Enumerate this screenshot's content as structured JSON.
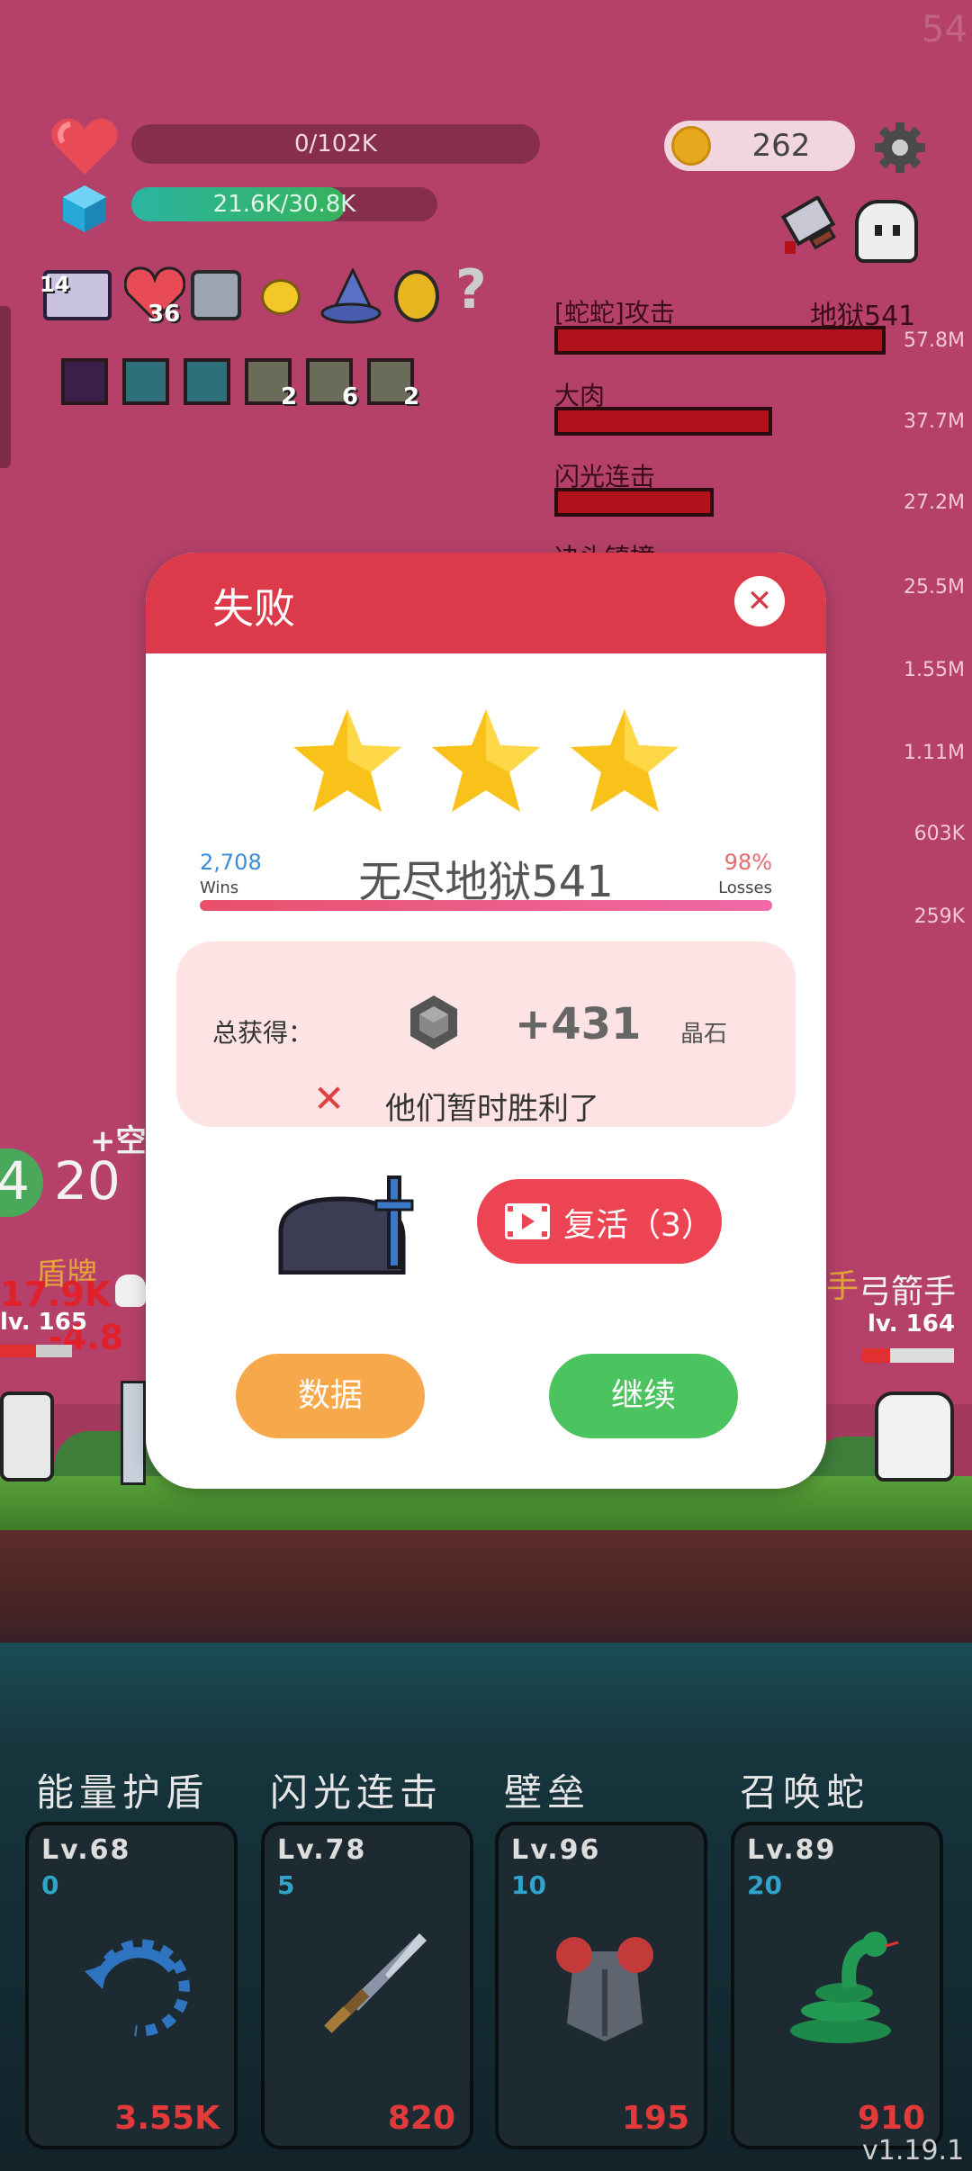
{
  "corner_number": "54",
  "hud": {
    "hp_text": "0/102K",
    "exp_text": "21.6K/30.8K",
    "exp_progress": 0.7,
    "coins": "262"
  },
  "items": [
    {
      "name": "item-1",
      "count": "14"
    },
    {
      "name": "heart-item",
      "count": "36"
    }
  ],
  "relics": [
    {
      "count": ""
    },
    {
      "count": ""
    },
    {
      "count": ""
    },
    {
      "count": "2"
    },
    {
      "count": "6"
    },
    {
      "count": "2"
    }
  ],
  "damage": {
    "header_left": "[蛇蛇]攻击",
    "header_right": "地狱541",
    "rows": [
      {
        "label": "[蛇蛇]攻击",
        "value": "57.8M",
        "fill": 1.0
      },
      {
        "label": "大肉",
        "value": "37.7M",
        "fill": 0.65
      },
      {
        "label": "闪光连击",
        "value": "27.2M",
        "fill": 0.47
      },
      {
        "label": "",
        "value": "25.5M",
        "fill": 0.44
      },
      {
        "label": "",
        "value": "1.55M",
        "fill": 0.03
      },
      {
        "label": "",
        "value": "1.11M",
        "fill": 0.02
      },
      {
        "label": "",
        "value": "603K",
        "fill": 0.01
      },
      {
        "label": "",
        "value": "259K",
        "fill": 0.005
      }
    ]
  },
  "battle": {
    "left_count": "20",
    "left_num_partial": "4",
    "left_float_text": "+空",
    "left_enemy_text": "盾牌",
    "left_dmg1": "17.9K",
    "left_dmg2": "-4.8",
    "left_level": "lv. 165",
    "right_name_partial": "手",
    "right_name": "弓箭手",
    "right_level": "lv. 164"
  },
  "dialog": {
    "title": "失败",
    "stars": 3,
    "wins": "2,708",
    "wins_label": "Wins",
    "loss_pct": "98%",
    "loss_label": "Losses",
    "stage": "无尽地狱541",
    "reward_label": "总获得：",
    "reward_amount": "+431",
    "reward_unit": "晶石",
    "fail_message": "他们暂时胜利了",
    "revive_label": "复活（3）",
    "data_label": "数据",
    "continue_label": "继续"
  },
  "skills": [
    {
      "name": "能量护盾",
      "level": "Lv.68",
      "num": "0",
      "cost": "3.55K",
      "icon": "refresh-icon"
    },
    {
      "name": "闪光连击",
      "level": "Lv.78",
      "num": "5",
      "cost": "820",
      "icon": "sword-icon"
    },
    {
      "name": "壁垒",
      "level": "Lv.96",
      "num": "10",
      "cost": "195",
      "icon": "armor-icon"
    },
    {
      "name": "召唤蛇",
      "level": "Lv.89",
      "num": "20",
      "cost": "910",
      "icon": "snake-icon"
    }
  ],
  "version": "v1.19.1",
  "colors": {
    "header_red": "#dc3a4a",
    "revive_red": "#ec4452",
    "data_orange": "#f7a84a",
    "continue_green": "#4bc35e"
  }
}
